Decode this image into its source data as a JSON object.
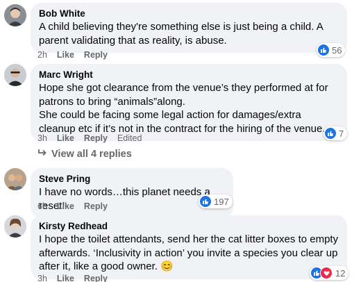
{
  "comments": [
    {
      "author": "Bob White",
      "text": "A child believing they're something else is just being a child. A parent validating that as reality, is abuse.",
      "time": "2h",
      "like_label": "Like",
      "reply_label": "Reply",
      "reaction_count": "56",
      "reactions": [
        "like"
      ]
    },
    {
      "author": "Marc Wright",
      "text_lines": [
        "Hope she got clearance from the venue’s they performed at for patrons to bring “animals”along.",
        "She could be facing some legal action for damages/extra cleanup etc if it’s not in the contract for the hiring of the venue.."
      ],
      "time": "3h",
      "like_label": "Like",
      "reply_label": "Reply",
      "edited_label": "Edited",
      "reaction_count": "7",
      "reactions": [
        "like"
      ],
      "view_replies": "View all 4 replies"
    },
    {
      "author": "Steve Pring",
      "text": "I have no words…this planet needs a reset!",
      "time": "6h",
      "like_label": "Like",
      "reply_label": "Reply",
      "reaction_count": "197",
      "reactions": [
        "like"
      ]
    },
    {
      "author": "Kirsty Redhead",
      "text": "I hope the toilet attendants, send her the cat litter boxes to empty afterwards. ‘Inclusivity in action’ you invite a species you clear up after it, like a good owner. 😊",
      "time": "3h",
      "like_label": "Like",
      "reply_label": "Reply",
      "reaction_count": "12",
      "reactions": [
        "like",
        "love"
      ]
    }
  ],
  "colors": {
    "bubble": "#f0f2f5",
    "secondary_text": "#65676b",
    "like_blue": "#1b74e4",
    "love_red": "#f02849"
  }
}
